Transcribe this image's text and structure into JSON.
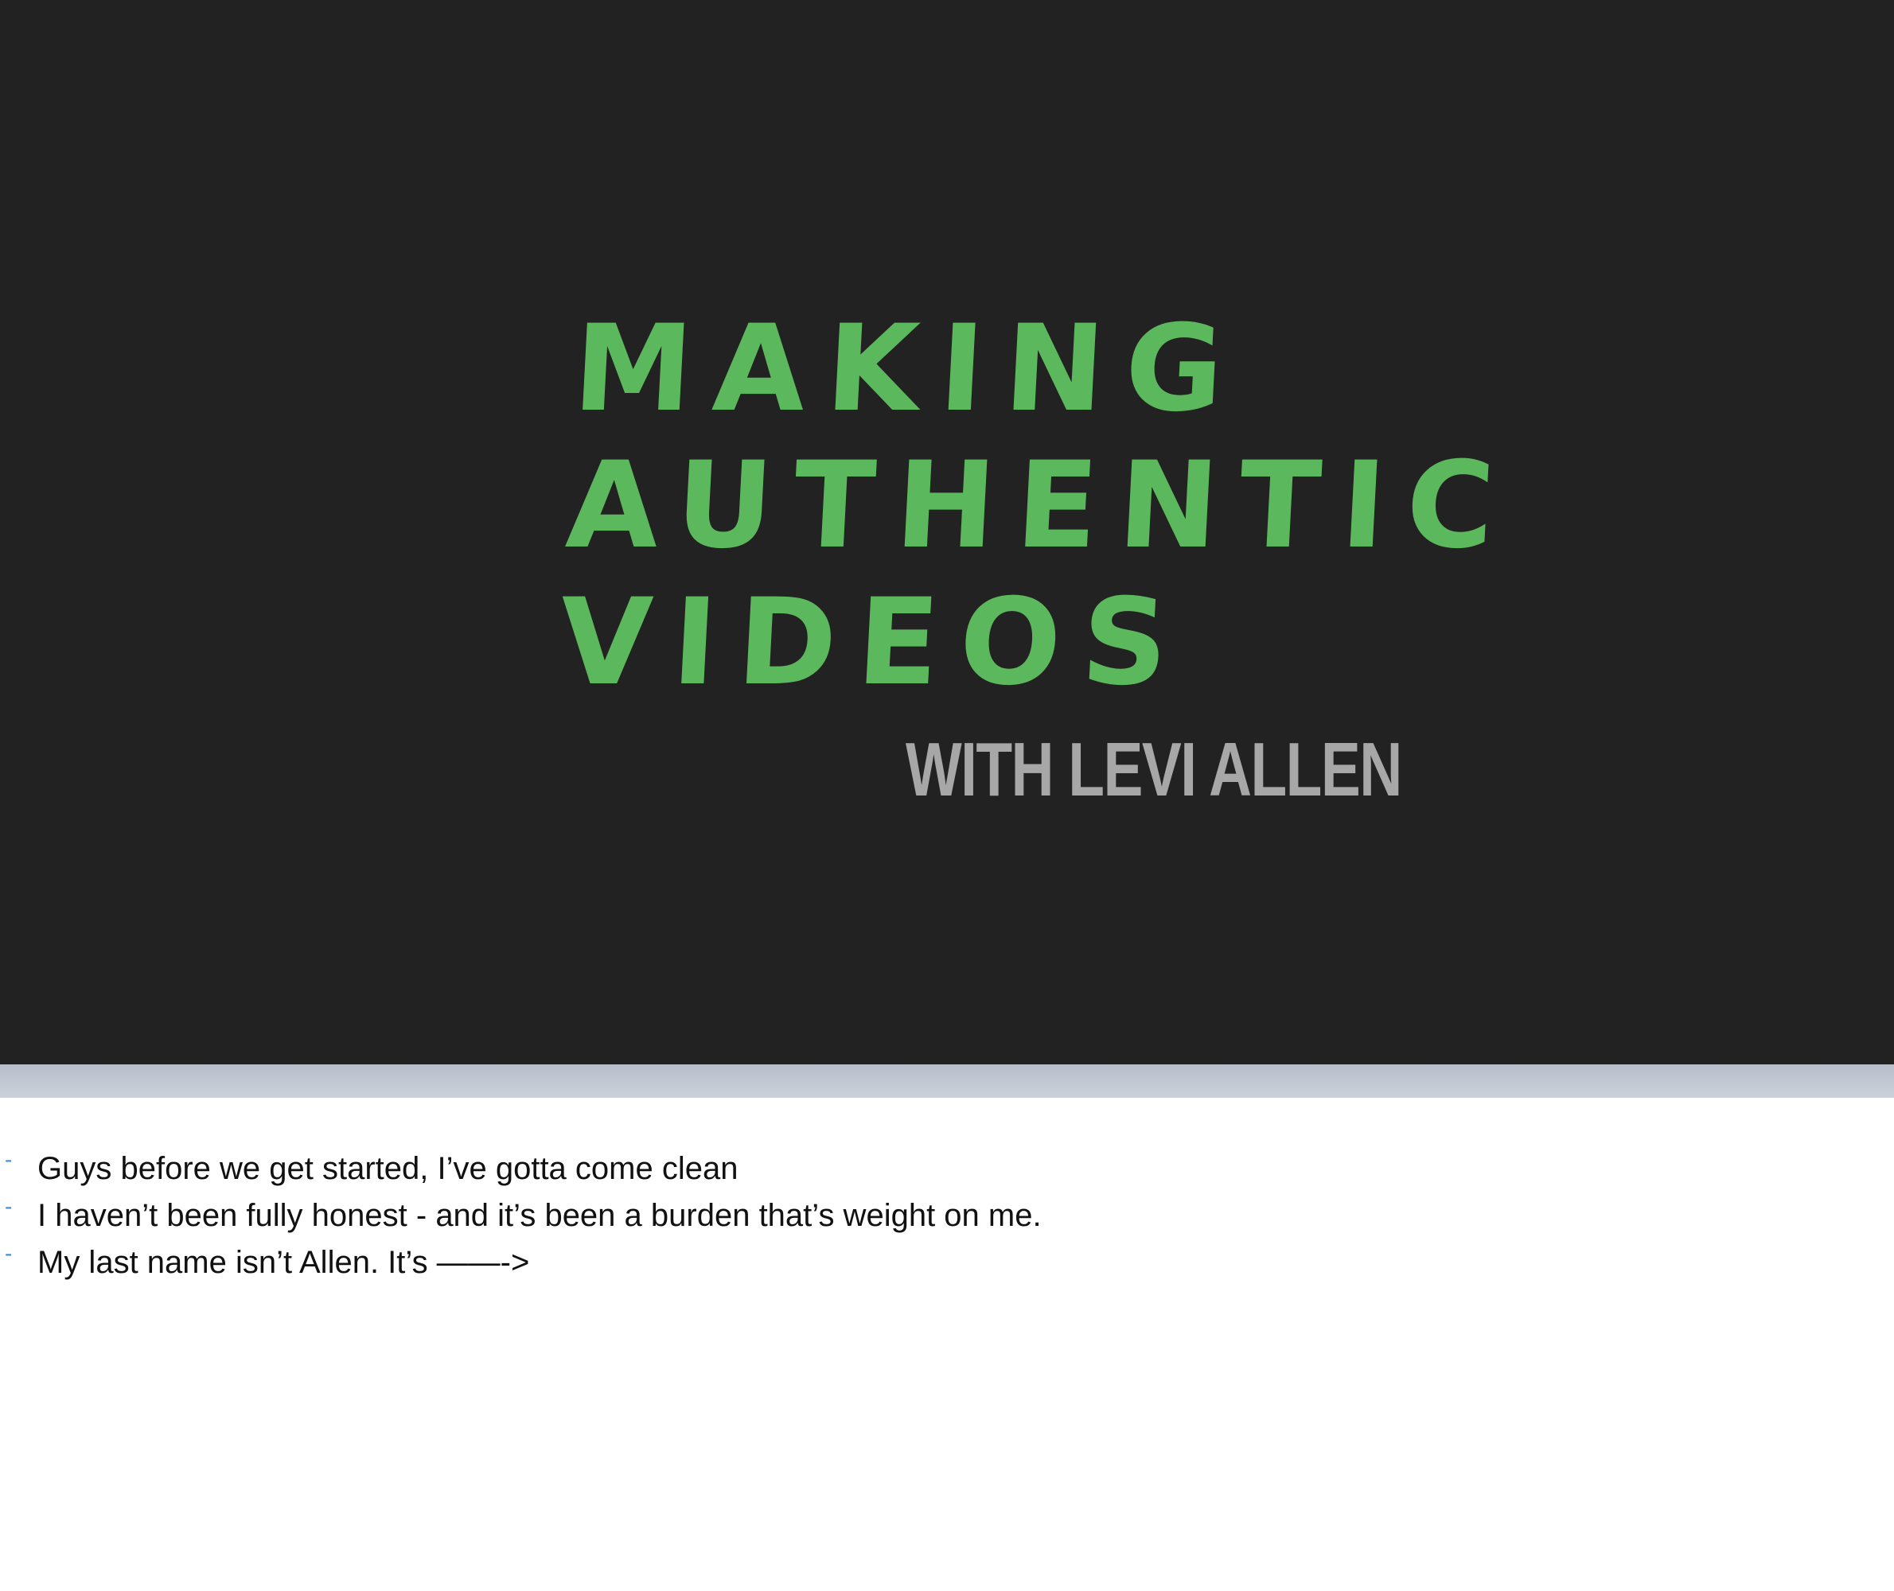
{
  "slide": {
    "title_lines": [
      "MAKING",
      "AUTHENTIC",
      "VIDEOS"
    ],
    "subtitle": "WITH LEVI ALLEN",
    "background_color": "#222222",
    "title_color": "#5cb85c",
    "subtitle_color": "#a7a7a7"
  },
  "notes": {
    "bullet_symbol": "-",
    "bullet_color": "#3a8fd6",
    "items": [
      "Guys before we get started, I’ve gotta come clean",
      "I haven’t been fully honest - and it’s been a burden that’s weight on me.",
      "My last name isn’t Allen. It’s ——->"
    ]
  }
}
